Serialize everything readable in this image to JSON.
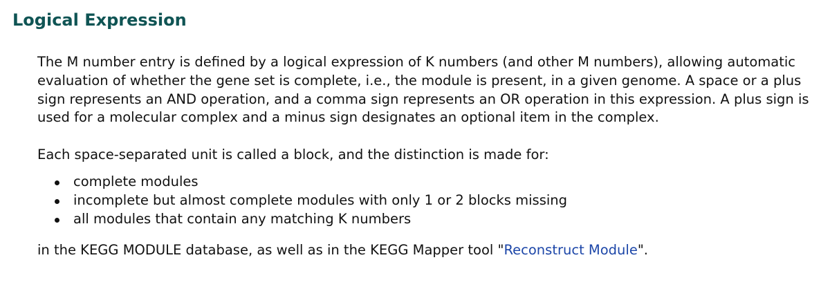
{
  "section": {
    "title": "Logical Expression"
  },
  "paragraphs": {
    "p1": "The M number entry is defined by a logical expression of K numbers (and other M numbers), allowing automatic evaluation of whether the gene set is complete, i.e., the module is present, in a given genome. A space or a plus sign represents an AND operation, and a comma sign represents an OR operation in this expression. A plus sign is used for a molecular complex and a minus sign designates an optional item in the complex.",
    "p2": "Each space-separated unit is called a block, and the distinction is made for:",
    "bullets": [
      "complete modules",
      "incomplete but almost complete modules with only 1 or 2 blocks missing",
      "all modules that contain any matching K numbers"
    ],
    "p3_before": "in the KEGG MODULE database, as well as in the KEGG Mapper tool \"",
    "p3_link": "Reconstruct Module",
    "p3_after": "\"."
  },
  "colors": {
    "heading": "#0f5454",
    "text": "#111111",
    "link": "#1c46a8"
  }
}
